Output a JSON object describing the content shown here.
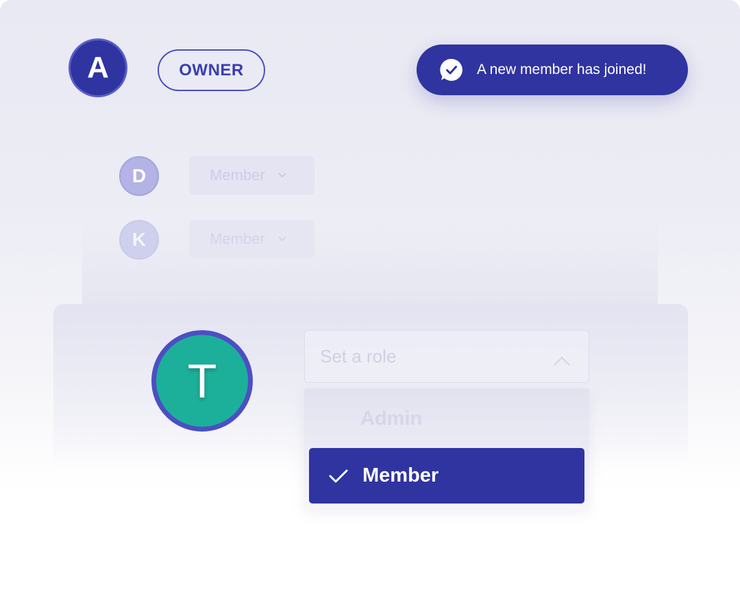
{
  "owner": {
    "avatar_initial": "A",
    "badge_label": "OWNER"
  },
  "toast": {
    "icon": "chat-check-icon",
    "message": "A new member has joined!"
  },
  "members": [
    {
      "initial": "D",
      "role": "Member",
      "status": ""
    },
    {
      "initial": "K",
      "role": "Member",
      "status": ""
    }
  ],
  "new_member": {
    "initial": "T",
    "role_select": {
      "placeholder": "Set a role",
      "icon": "chevron-up-icon"
    },
    "role_options": [
      {
        "label": "Admin",
        "selected": false
      },
      {
        "label": "Member",
        "selected": true,
        "icon": "check-icon"
      }
    ]
  },
  "colors": {
    "primary": "#3034a0",
    "accent_ring": "#4c4fc4",
    "teal_avatar": "#1cb09a",
    "background": "#ececf5"
  }
}
